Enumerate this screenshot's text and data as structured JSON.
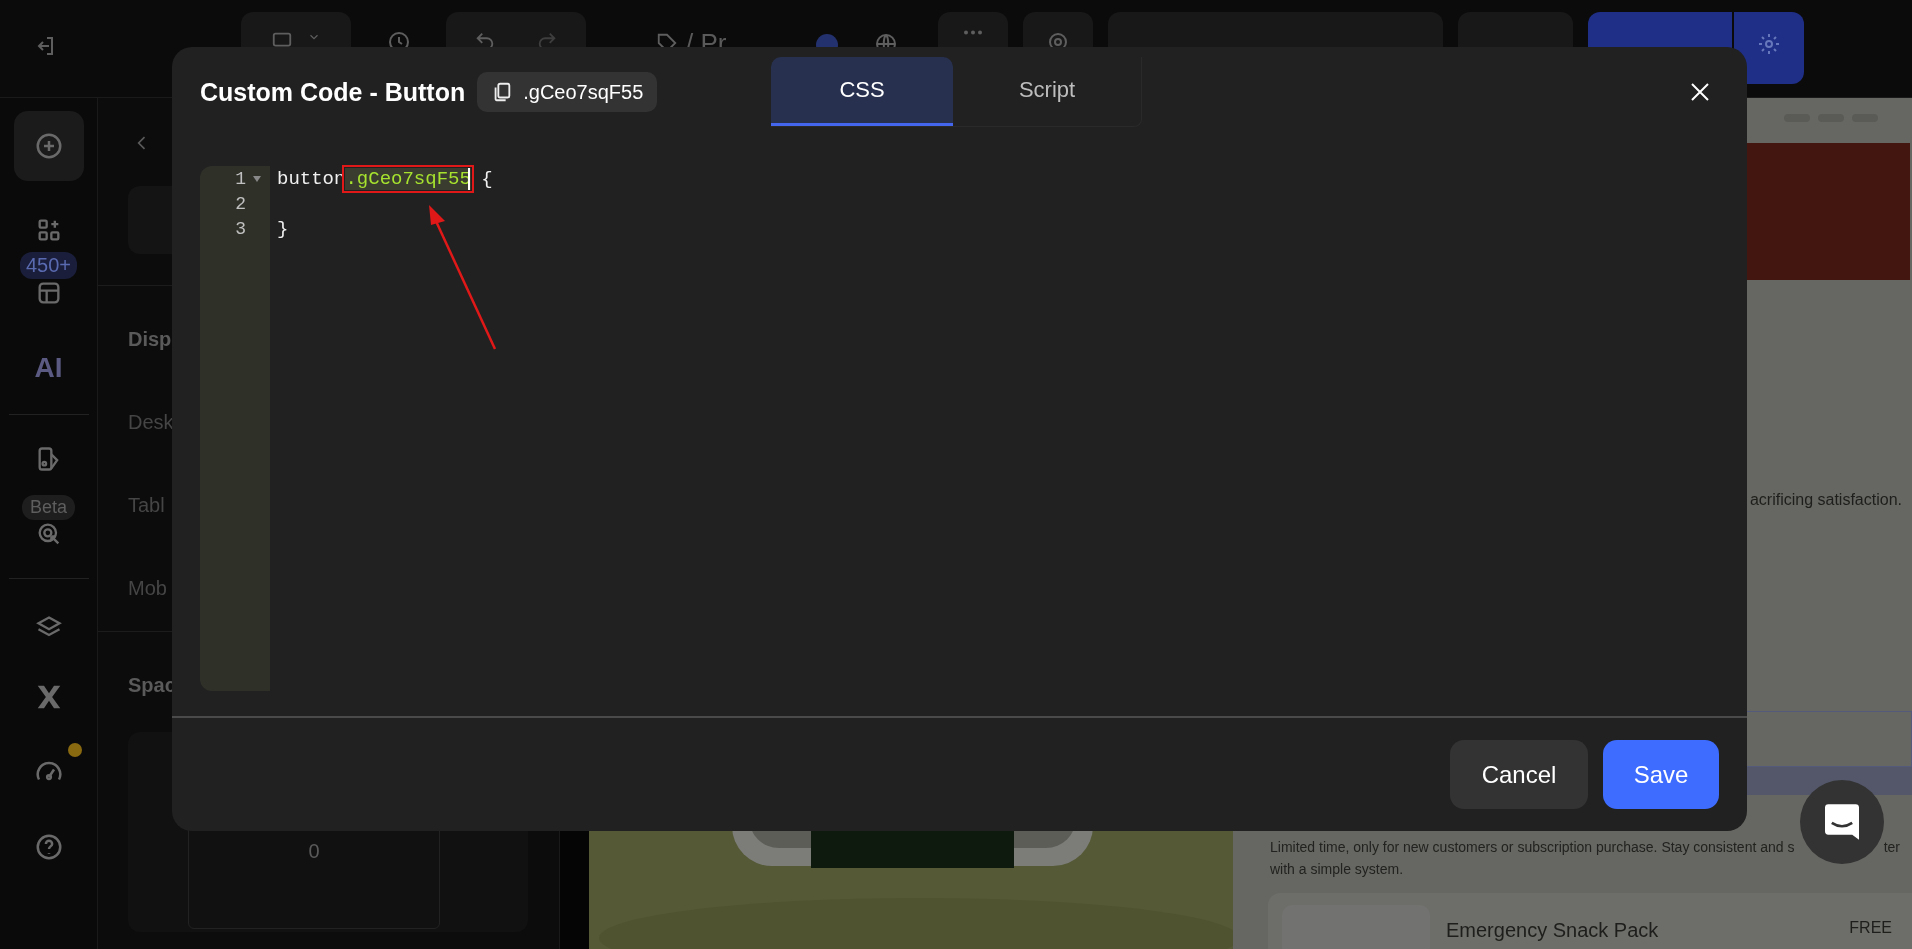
{
  "top_bar": {
    "page_title": "/ Pr"
  },
  "rail": {
    "templates_badge": "450+",
    "ai": "AI",
    "beta_badge": "Beta",
    "speed_alert": true
  },
  "settings_panel": {
    "display_heading": "Disp",
    "devices": [
      "Desk",
      "Tabl",
      "Mob"
    ],
    "spacing_heading": "Spac",
    "spacing_value": "0"
  },
  "canvas": {
    "description_tail": "acrificing satisfaction.",
    "offer_line_1": "Limited time, only for new customers or subscription purchase. Stay consistent and s",
    "offer_line_1_tail": "ter",
    "offer_line_2": "with a simple system.",
    "product": {
      "name": "Emergency Snack Pack",
      "price": "FREE"
    }
  },
  "dialog": {
    "title": "Custom Code - Button",
    "class_chip": ".gCeo7sqF55",
    "tabs": [
      {
        "label": "CSS",
        "selected": true
      },
      {
        "label": "Script",
        "selected": false
      }
    ],
    "code_lines": [
      {
        "number": "1",
        "foldable": true,
        "tokens": [
          {
            "text": "button",
            "kind": "plain",
            "highlighted": false
          },
          {
            "text": ".gCeo7sqF55",
            "kind": "class",
            "highlighted": true
          },
          {
            "text": " {",
            "kind": "plain",
            "highlighted": false
          }
        ]
      },
      {
        "number": "2",
        "foldable": false
      },
      {
        "number": "3",
        "foldable": false,
        "tokens": [
          {
            "text": "}",
            "kind": "plain",
            "highlighted": false
          }
        ]
      }
    ],
    "buttons": [
      {
        "label": "Cancel",
        "kind": "secondary"
      },
      {
        "label": "Save",
        "kind": "primary"
      }
    ]
  }
}
